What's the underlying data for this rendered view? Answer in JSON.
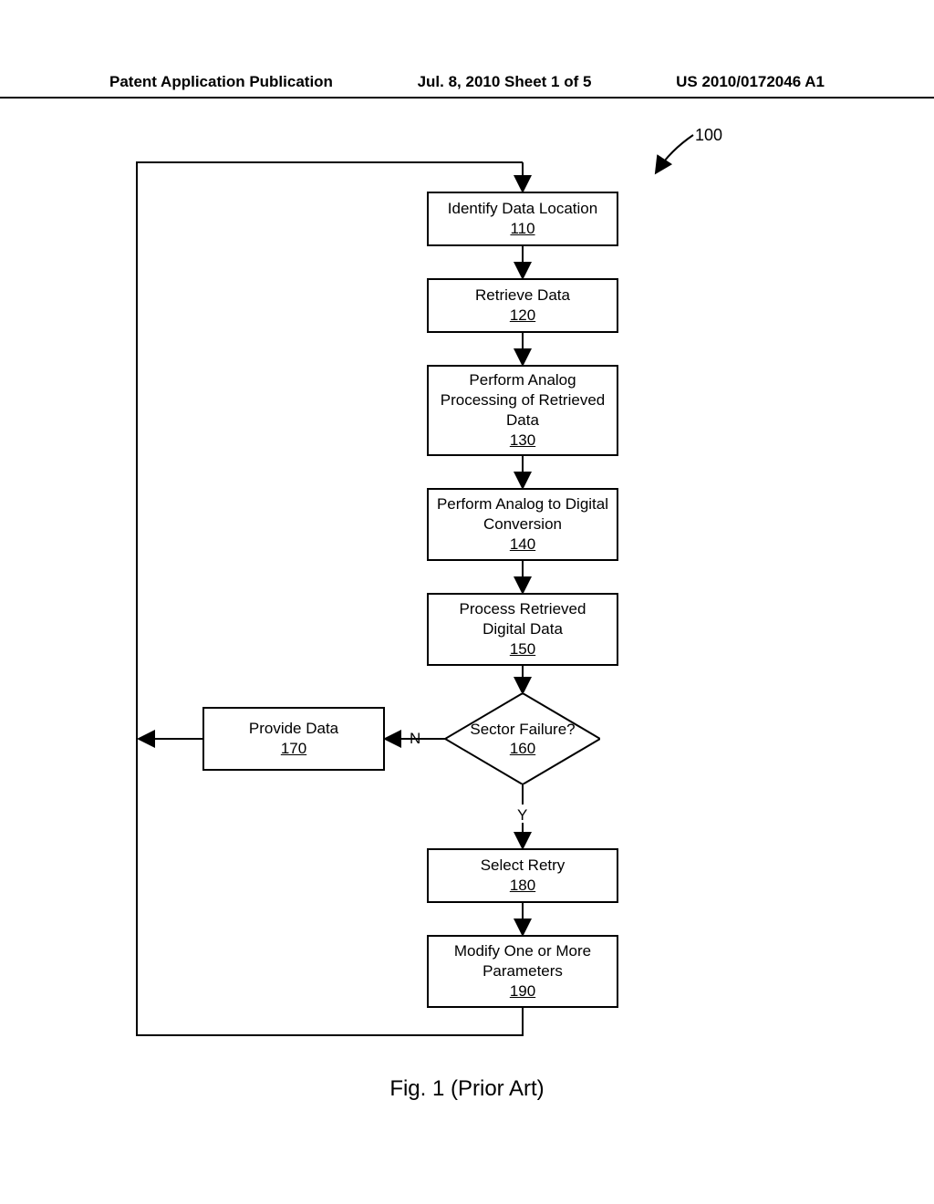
{
  "header": {
    "left": "Patent Application Publication",
    "center": "Jul. 8, 2010  Sheet 1 of 5",
    "right": "US 2010/0172046 A1"
  },
  "diagram": {
    "ref100": "100",
    "boxes": {
      "b110": {
        "text": "Identify Data Location",
        "ref": "110"
      },
      "b120": {
        "text": "Retrieve Data",
        "ref": "120"
      },
      "b130": {
        "text": "Perform Analog Processing of Retrieved Data",
        "ref": "130"
      },
      "b140": {
        "text": "Perform Analog to Digital Conversion",
        "ref": "140"
      },
      "b150": {
        "text": "Process Retrieved Digital Data",
        "ref": "150"
      },
      "d160": {
        "text": "Sector Failure?",
        "ref": "160"
      },
      "b170": {
        "text": "Provide Data",
        "ref": "170"
      },
      "b180": {
        "text": "Select Retry",
        "ref": "180"
      },
      "b190": {
        "text": "Modify One or More Parameters",
        "ref": "190"
      }
    },
    "edges": {
      "no": "N",
      "yes": "Y"
    }
  },
  "caption": "Fig. 1 (Prior Art)"
}
